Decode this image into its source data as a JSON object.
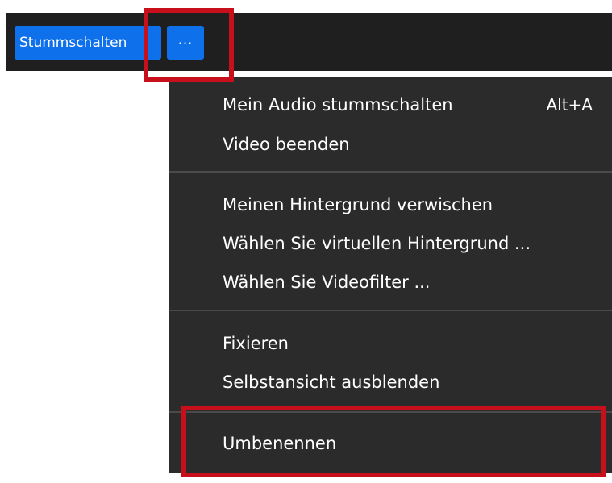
{
  "toolbar": {
    "mute_label": "Stummschalten",
    "more_label": "···"
  },
  "menu": {
    "items": [
      {
        "label": "Mein Audio stummschalten",
        "shortcut": "Alt+A"
      },
      {
        "label": "Video beenden"
      },
      {
        "label": "Meinen Hintergrund verwischen"
      },
      {
        "label": "Wählen Sie virtuellen Hintergrund ..."
      },
      {
        "label": "Wählen Sie Videofilter ..."
      },
      {
        "label": "Fixieren"
      },
      {
        "label": "Selbstansicht ausblenden"
      },
      {
        "label": "Umbenennen"
      }
    ]
  },
  "colors": {
    "button_blue": "#0e71eb",
    "menu_background": "#2b2b2b",
    "highlight_red": "#c8101c"
  }
}
